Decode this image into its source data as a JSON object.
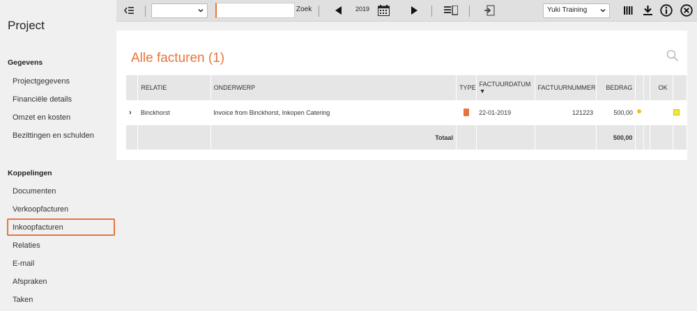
{
  "sidebar": {
    "title": "Project",
    "sections": [
      {
        "label": "Gegevens"
      },
      {
        "label": "Koppelingen"
      }
    ],
    "gegevens_items": [
      "Projectgegevens",
      "Financiële details",
      "Omzet en kosten",
      "Bezittingen en schulden"
    ],
    "koppelingen_items": [
      "Documenten",
      "Verkoopfacturen",
      "Inkoopfacturen",
      "Relaties",
      "E-mail",
      "Afspraken",
      "Taken"
    ],
    "active_item": "Inkoopfacturen"
  },
  "toolbar": {
    "filter_select_value": "",
    "search_value": "",
    "search_label": "Zoek",
    "year": "2019",
    "company_select_value": "Yuki Training"
  },
  "main": {
    "heading": "Alle facturen (1)",
    "columns": [
      "",
      "RELATIE",
      "ONDERWERP",
      "TYPE",
      "FACTUURDATUM ▼",
      "FACTUURNUMMER",
      "BEDRAG",
      "",
      "",
      "OK"
    ],
    "rows": [
      {
        "relatie": "Binckhorst",
        "onderwerp": "Invoice from Binckhorst, Inkopen Catering",
        "factuurdatum": "22-01-2019",
        "factuurnummer": "121223",
        "bedrag": "500,00"
      }
    ],
    "total_label": "Totaal",
    "total_value": "500,00"
  },
  "colors": {
    "accent": "#e8743b",
    "toolbar_bg": "#e0e0e0",
    "header_bg": "#e6e6e6"
  }
}
